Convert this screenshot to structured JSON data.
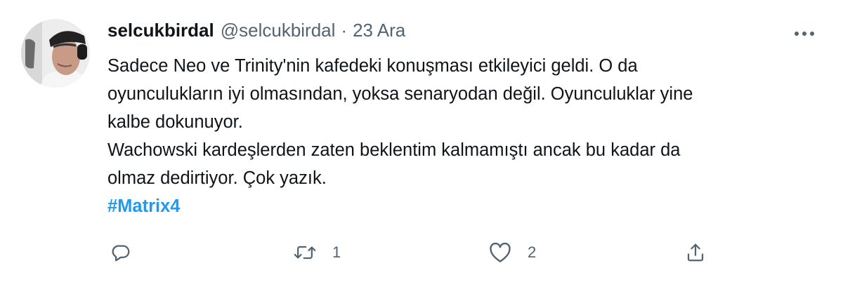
{
  "tweet": {
    "author": {
      "name": "selcukbirdal",
      "handle": "@selcukbirdal",
      "separator": "·",
      "date": "23 Ara"
    },
    "text_lines": [
      "Sadece Neo ve Trinity'nin kafedeki konuşması etkileyici geldi. O da",
      "oyunculukların iyi olmasından, yoksa senaryodan değil. Oyunculuklar yine",
      "kalbe dokunuyor.",
      "Wachowski kardeşlerden zaten beklentim kalmamıştı ancak bu kadar da",
      "olmaz dedirtiyor. Çok yazık."
    ],
    "hashtag": "#Matrix4",
    "actions": {
      "reply": {
        "icon": "reply-icon",
        "count": ""
      },
      "retweet": {
        "icon": "retweet-icon",
        "count": "1"
      },
      "like": {
        "icon": "heart-icon",
        "count": "2"
      },
      "share": {
        "icon": "share-icon"
      }
    },
    "more_icon": "more-options-icon"
  },
  "colors": {
    "text": "#0f1419",
    "secondary": "#536471",
    "accent": "#1d9bf0",
    "background": "#ffffff"
  }
}
